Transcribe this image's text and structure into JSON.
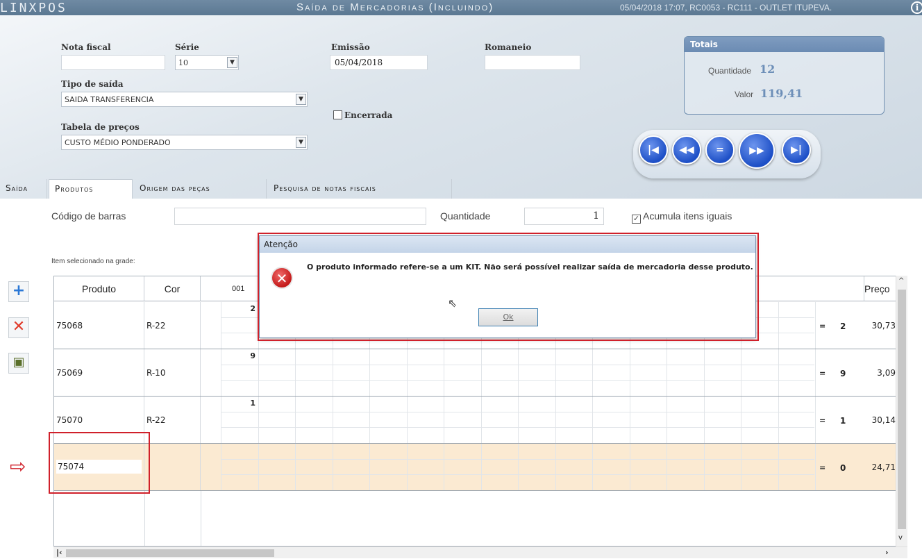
{
  "app": {
    "logo": "LINXPOS",
    "title": "Saída de Mercadorias (Incluindo)",
    "session_info": "05/04/2018 17:07, RC0053 - RC111 - OUTLET ITUPEVA.",
    "info_icon": "i"
  },
  "header": {
    "nota_fiscal_label": "Nota fiscal",
    "nota_fiscal_value": "",
    "serie_label": "Série",
    "serie_value": "10",
    "emissao_label": "Emissão",
    "emissao_value": "05/04/2018",
    "romaneio_label": "Romaneio",
    "romaneio_value": "",
    "tipo_saida_label": "Tipo de saída",
    "tipo_saida_value": "SAIDA TRANSFERENCIA",
    "encerrada_label": "Encerrada",
    "encerrada_checked": false,
    "tabela_precos_label": "Tabela de preços",
    "tabela_precos_value": "CUSTO MÉDIO PONDERADO"
  },
  "totais": {
    "title": "Totais",
    "quantidade_label": "Quantidade",
    "quantidade_value": "12",
    "valor_label": "Valor",
    "valor_value": "119,41"
  },
  "nav_buttons": [
    "first-icon",
    "previous-icon",
    "record-icon",
    "next-icon",
    "last-icon"
  ],
  "tabs": [
    {
      "label": "Saída",
      "active": false
    },
    {
      "label": "Produtos",
      "active": true
    },
    {
      "label": "Origem das peças",
      "active": false
    },
    {
      "label": "Pesquisa de notas fiscais",
      "active": false
    }
  ],
  "produtos": {
    "codigo_barras_label": "Código de barras",
    "codigo_barras_value": "",
    "quantidade_label": "Quantidade",
    "quantidade_value": "1",
    "acumula_label": "Acumula itens iguais",
    "acumula_checked": true,
    "item_selecionado_label": "Item selecionado na grade:"
  },
  "grid": {
    "headers": {
      "produto": "Produto",
      "cor": "Cor",
      "size1": "001",
      "preco": "Preço"
    },
    "rows": [
      {
        "produto": "75068",
        "cor": "R-22",
        "count": "2",
        "eq": "=",
        "qty": "2",
        "preco": "30,73"
      },
      {
        "produto": "75069",
        "cor": "R-10",
        "count": "9",
        "eq": "=",
        "qty": "9",
        "preco": "3,09"
      },
      {
        "produto": "75070",
        "cor": "R-22",
        "count": "1",
        "eq": "=",
        "qty": "1",
        "preco": "30,14"
      },
      {
        "produto": "75074",
        "cor": "",
        "count": "",
        "eq": "=",
        "qty": "0",
        "preco": "24,71"
      }
    ]
  },
  "dialog": {
    "title": "Atenção",
    "message": "O produto informado refere-se a um KIT. Não será possível realizar saída de mercadoria desse produto.",
    "ok_label": "Ok",
    "icon": "error-icon"
  },
  "colors": {
    "titlebar": "#5b7892",
    "accent": "#6d8fb8",
    "highlight_row": "#fbead2",
    "annotation_red": "#d0202a"
  }
}
